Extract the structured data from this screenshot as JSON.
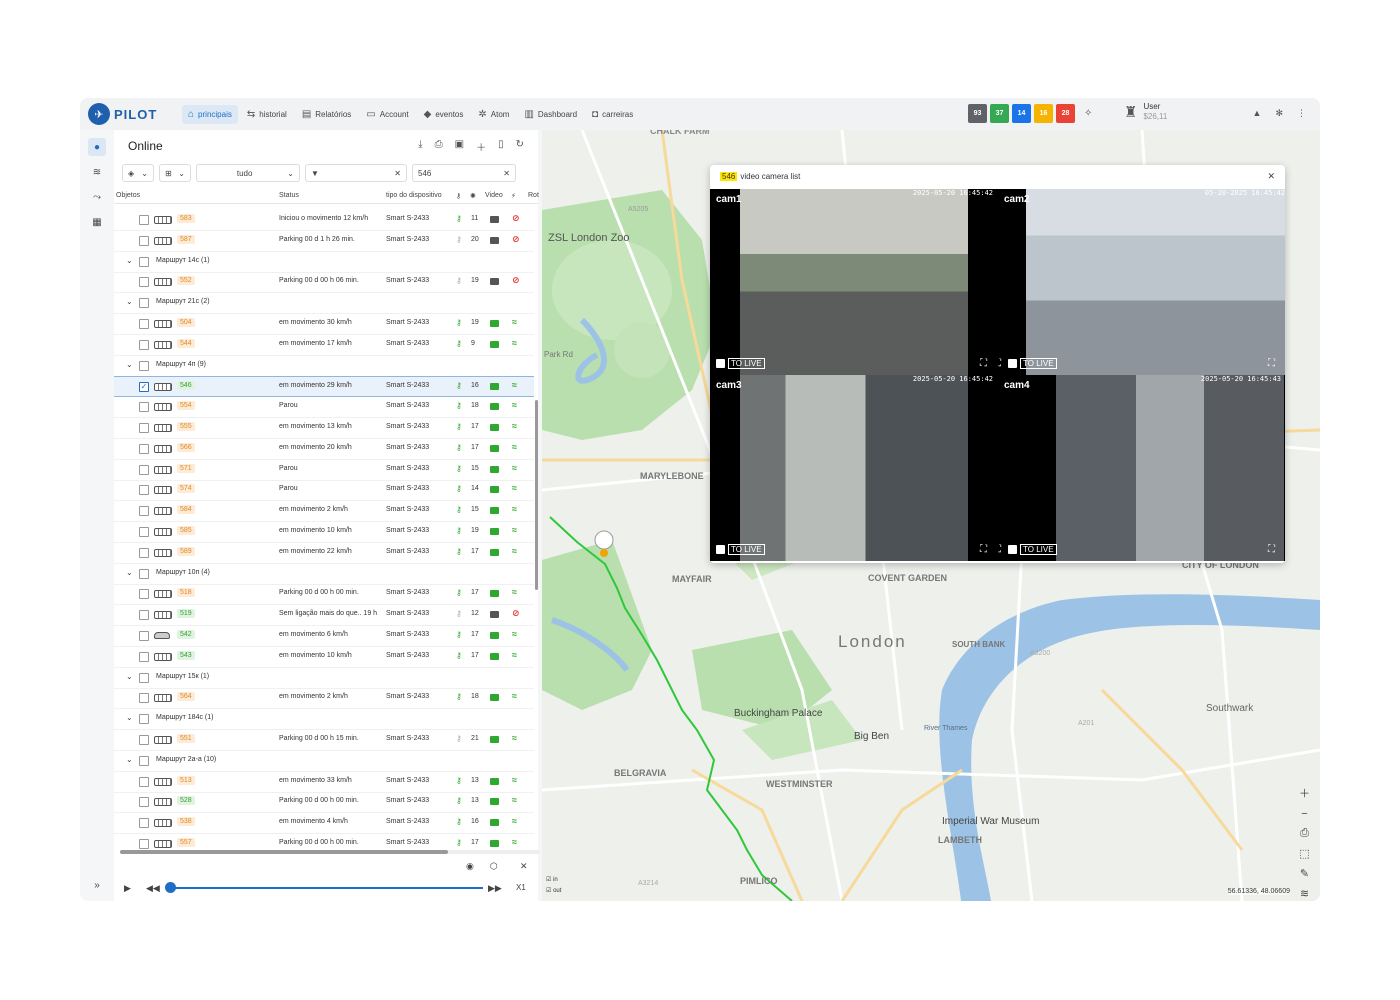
{
  "app": {
    "logo_text": "PILOT"
  },
  "nav": [
    {
      "label": "principais",
      "icon": "home-icon",
      "glyph": "⌂",
      "active": true
    },
    {
      "label": "historial",
      "icon": "route-icon",
      "glyph": "⇆",
      "active": false
    },
    {
      "label": "Relatórios",
      "icon": "report-icon",
      "glyph": "▤",
      "active": false
    },
    {
      "label": "Account",
      "icon": "account-icon",
      "glyph": "▭",
      "active": false
    },
    {
      "label": "eventos",
      "icon": "bell-icon",
      "glyph": "◆",
      "active": false
    },
    {
      "label": "Atom",
      "icon": "atom-icon",
      "glyph": "✲",
      "active": false
    },
    {
      "label": "Dashboard",
      "icon": "dashboard-icon",
      "glyph": "▥",
      "active": false
    },
    {
      "label": "carreiras",
      "icon": "bus-icon",
      "glyph": "◘",
      "active": false
    }
  ],
  "status_badges": [
    {
      "value": "93",
      "color": "#5f6368"
    },
    {
      "value": "37",
      "color": "#34a853"
    },
    {
      "value": "14",
      "color": "#1a73e8"
    },
    {
      "value": "16",
      "color": "#f4b400"
    },
    {
      "value": "28",
      "color": "#ea4335"
    }
  ],
  "user": {
    "name": "User",
    "balance": "$26,11"
  },
  "panel": {
    "title": "Online",
    "filter_select": "tudo",
    "search_value": "546",
    "columns": {
      "objects": "Objetos",
      "status": "Status",
      "device": "tipo do dispositivo",
      "video": "Video",
      "route": "Rot"
    }
  },
  "rows": [
    {
      "kind": "item",
      "num": "583",
      "numc": "orange",
      "veh": "bus",
      "status": "Iniciou o movimento 12 km/h",
      "device": "Smart S-2433",
      "key": "g",
      "sat": "11",
      "cam": "gr",
      "wifi": "r"
    },
    {
      "kind": "item",
      "num": "587",
      "numc": "orange",
      "veh": "bus",
      "status": "Parking 00 d 1 h 26 min.",
      "device": "Smart S-2433",
      "key": "gr",
      "sat": "20",
      "cam": "gr",
      "wifi": "r"
    },
    {
      "kind": "group",
      "label": "Маршрут 14с (1)"
    },
    {
      "kind": "item",
      "num": "552",
      "numc": "orange",
      "veh": "bus",
      "status": "Parking 00 d 00 h 06 min.",
      "device": "Smart S-2433",
      "key": "gr",
      "sat": "19",
      "cam": "gr",
      "wifi": "r"
    },
    {
      "kind": "group",
      "label": "Маршрут 21с (2)"
    },
    {
      "kind": "item",
      "num": "504",
      "numc": "orange",
      "veh": "bus",
      "status": "em movimento 30 km/h",
      "device": "Smart S-2433",
      "key": "g",
      "sat": "19",
      "cam": "g",
      "wifi": "g"
    },
    {
      "kind": "item",
      "num": "544",
      "numc": "orange",
      "veh": "bus",
      "status": "em movimento 17 km/h",
      "device": "Smart S-2433",
      "key": "g",
      "sat": "9",
      "cam": "g",
      "wifi": "g"
    },
    {
      "kind": "group",
      "label": "Маршрут 4п (9)"
    },
    {
      "kind": "item",
      "num": "546",
      "numc": "green",
      "veh": "bus",
      "status": "em movimento 29 km/h",
      "device": "Smart S-2433",
      "key": "g",
      "sat": "16",
      "cam": "g",
      "wifi": "g",
      "selected": true
    },
    {
      "kind": "item",
      "num": "554",
      "numc": "orange",
      "veh": "bus",
      "status": "Parou",
      "device": "Smart S-2433",
      "key": "g",
      "sat": "18",
      "cam": "g",
      "wifi": "g"
    },
    {
      "kind": "item",
      "num": "555",
      "numc": "orange",
      "veh": "bus",
      "status": "em movimento 13 km/h",
      "device": "Smart S-2433",
      "key": "g",
      "sat": "17",
      "cam": "g",
      "wifi": "g"
    },
    {
      "kind": "item",
      "num": "566",
      "numc": "orange",
      "veh": "bus",
      "status": "em movimento 20 km/h",
      "device": "Smart S-2433",
      "key": "g",
      "sat": "17",
      "cam": "g",
      "wifi": "g"
    },
    {
      "kind": "item",
      "num": "571",
      "numc": "orange",
      "veh": "bus",
      "status": "Parou",
      "device": "Smart S-2433",
      "key": "g",
      "sat": "15",
      "cam": "g",
      "wifi": "g"
    },
    {
      "kind": "item",
      "num": "574",
      "numc": "orange",
      "veh": "bus",
      "status": "Parou",
      "device": "Smart S-2433",
      "key": "g",
      "sat": "14",
      "cam": "g",
      "wifi": "g"
    },
    {
      "kind": "item",
      "num": "584",
      "numc": "orange",
      "veh": "bus",
      "status": "em movimento 2 km/h",
      "device": "Smart S-2433",
      "key": "g",
      "sat": "15",
      "cam": "g",
      "wifi": "g"
    },
    {
      "kind": "item",
      "num": "585",
      "numc": "orange",
      "veh": "bus",
      "status": "em movimento 10 km/h",
      "device": "Smart S-2433",
      "key": "g",
      "sat": "19",
      "cam": "g",
      "wifi": "g"
    },
    {
      "kind": "item",
      "num": "589",
      "numc": "orange",
      "veh": "bus",
      "status": "em movimento 22 km/h",
      "device": "Smart S-2433",
      "key": "g",
      "sat": "17",
      "cam": "g",
      "wifi": "g"
    },
    {
      "kind": "group",
      "label": "Маршрут 10п (4)"
    },
    {
      "kind": "item",
      "num": "518",
      "numc": "orange",
      "veh": "bus",
      "status": "Parking 00 d 00 h 00 min.",
      "device": "Smart S-2433",
      "key": "g",
      "sat": "17",
      "cam": "g",
      "wifi": "g"
    },
    {
      "kind": "item",
      "num": "519",
      "numc": "green",
      "veh": "bus",
      "status": "Sem ligação mais do que.. 19 h",
      "device": "Smart S-2433",
      "key": "gr",
      "sat": "12",
      "cam": "gr",
      "wifi": "r"
    },
    {
      "kind": "item",
      "num": "542",
      "numc": "green",
      "veh": "car",
      "status": "em movimento 6 km/h",
      "device": "Smart S-2433",
      "key": "g",
      "sat": "17",
      "cam": "g",
      "wifi": "g"
    },
    {
      "kind": "item",
      "num": "543",
      "numc": "green",
      "veh": "bus",
      "status": "em movimento 10 km/h",
      "device": "Smart S-2433",
      "key": "g",
      "sat": "17",
      "cam": "g",
      "wifi": "g"
    },
    {
      "kind": "group",
      "label": "Маршрут 15к (1)"
    },
    {
      "kind": "item",
      "num": "564",
      "numc": "orange",
      "veh": "bus",
      "status": "em movimento 2 km/h",
      "device": "Smart S-2433",
      "key": "g",
      "sat": "18",
      "cam": "g",
      "wifi": "g"
    },
    {
      "kind": "group",
      "label": "Маршрут 184с (1)"
    },
    {
      "kind": "item",
      "num": "551",
      "numc": "orange",
      "veh": "bus",
      "status": "Parking 00 d 00 h 15 min.",
      "device": "Smart S-2433",
      "key": "gr",
      "sat": "21",
      "cam": "g",
      "wifi": "g"
    },
    {
      "kind": "group",
      "label": "Маршрут 2а-а (10)"
    },
    {
      "kind": "item",
      "num": "513",
      "numc": "orange",
      "veh": "bus",
      "status": "em movimento 33 km/h",
      "device": "Smart S-2433",
      "key": "g",
      "sat": "13",
      "cam": "g",
      "wifi": "g"
    },
    {
      "kind": "item",
      "num": "528",
      "numc": "green",
      "veh": "bus",
      "status": "Parking 00 d 00 h 00 min.",
      "device": "Smart S-2433",
      "key": "g",
      "sat": "13",
      "cam": "g",
      "wifi": "g"
    },
    {
      "kind": "item",
      "num": "538",
      "numc": "orange",
      "veh": "bus",
      "status": "em movimento 4 km/h",
      "device": "Smart S-2433",
      "key": "g",
      "sat": "16",
      "cam": "g",
      "wifi": "g"
    },
    {
      "kind": "item",
      "num": "557",
      "numc": "orange",
      "veh": "bus",
      "status": "Parking 00 d 00 h 00 min.",
      "device": "Smart S-2433",
      "key": "g",
      "sat": "17",
      "cam": "g",
      "wifi": "g"
    }
  ],
  "player": {
    "speed": "X1"
  },
  "video_popup": {
    "vehicle": "546",
    "title": "video camera list",
    "cams": [
      {
        "label": "cam1",
        "ts": "2025-05-20 16:45:42",
        "live": "TO LIVE"
      },
      {
        "label": "cam2",
        "ts": "05-20-2025 16:45:42",
        "live": "TO LIVE"
      },
      {
        "label": "cam3",
        "ts": "2025-05-20 16:45:42",
        "live": "TO LIVE"
      },
      {
        "label": "cam4",
        "ts": "2025-05-20 16:45:43",
        "live": "TO LIVE"
      }
    ]
  },
  "map": {
    "labels": [
      {
        "text": "CHALK FARM",
        "cls": "district"
      },
      {
        "text": "ZSL London Zoo",
        "cls": "poi"
      },
      {
        "text": "A5205",
        "cls": "road"
      },
      {
        "text": "Park Rd",
        "cls": "road"
      },
      {
        "text": "MARYLEBONE",
        "cls": "district"
      },
      {
        "text": "MAYFAIR",
        "cls": "district"
      },
      {
        "text": "COVENT GARDEN",
        "cls": "district"
      },
      {
        "text": "CITY OF LONDON",
        "cls": "district"
      },
      {
        "text": "London",
        "cls": "city"
      },
      {
        "text": "SOUTH BANK",
        "cls": "district"
      },
      {
        "text": "A3200",
        "cls": "road"
      },
      {
        "text": "Buckingham Palace",
        "cls": "poi"
      },
      {
        "text": "Big Ben",
        "cls": "poi"
      },
      {
        "text": "River Thames",
        "cls": "water"
      },
      {
        "text": "Southwark",
        "cls": "poi"
      },
      {
        "text": "BELGRAVIA",
        "cls": "district"
      },
      {
        "text": "WESTMINSTER",
        "cls": "district"
      },
      {
        "text": "Imperial War Museum",
        "cls": "poi"
      },
      {
        "text": "LAMBETH",
        "cls": "district"
      },
      {
        "text": "PIMLICO",
        "cls": "district"
      },
      {
        "text": "A201",
        "cls": "road"
      },
      {
        "text": "A3214",
        "cls": "road"
      }
    ],
    "coords": "56.61336, 48.06609",
    "legend_in": "in",
    "legend_out": "out"
  }
}
